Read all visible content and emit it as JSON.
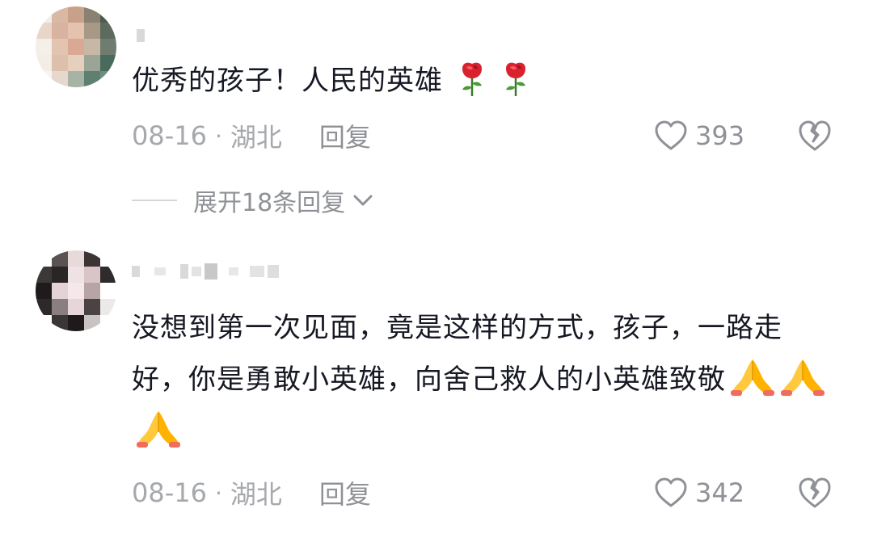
{
  "comments": [
    {
      "text": "优秀的孩子！人民的英雄",
      "emoji": [
        "rose-emoji",
        "rose-emoji"
      ],
      "date": "08-16",
      "separator": "·",
      "location": "湖北",
      "reply_label": "回复",
      "likes": "393",
      "expand_label": "展开18条回复"
    },
    {
      "text": "没想到第一次见面，竟是这样的方式，孩子，一路走好，你是勇敢小英雄，向舍己救人的小英雄致敬",
      "emoji": [
        "folded-hands-emoji",
        "folded-hands-emoji",
        "folded-hands-emoji"
      ],
      "date": "08-16",
      "separator": "·",
      "location": "湖北",
      "reply_label": "回复",
      "likes": "342"
    }
  ],
  "colors": {
    "text": "#161823",
    "meta": "#a6a8ad",
    "secondary": "#8f9196"
  }
}
